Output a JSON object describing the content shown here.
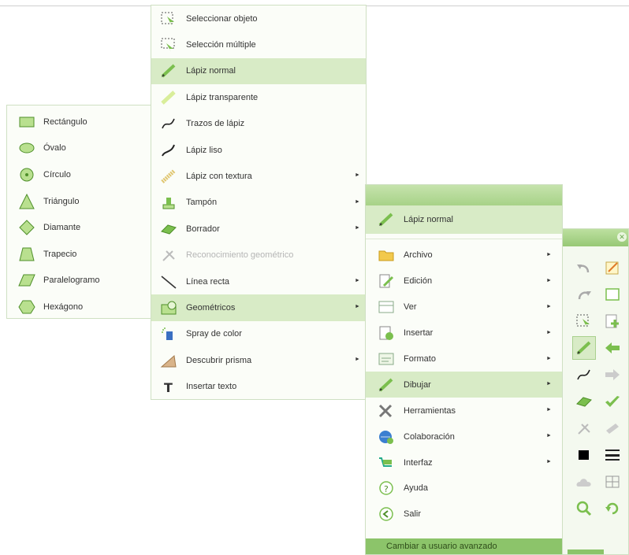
{
  "colors": {
    "accent": "#8cc46a",
    "highlight": "#d8ebc6",
    "border": "#cfe0c3"
  },
  "geometric_menu": {
    "items": [
      {
        "label": "Rectángulo",
        "icon": "rectangle-icon"
      },
      {
        "label": "Óvalo",
        "icon": "oval-icon"
      },
      {
        "label": "Círculo",
        "icon": "circle-icon"
      },
      {
        "label": "Triángulo",
        "icon": "triangle-icon"
      },
      {
        "label": "Diamante",
        "icon": "diamond-icon"
      },
      {
        "label": "Trapecio",
        "icon": "trapezoid-icon"
      },
      {
        "label": "Paralelogramo",
        "icon": "parallelogram-icon"
      },
      {
        "label": "Hexágono",
        "icon": "hexagon-icon"
      }
    ]
  },
  "draw_menu": {
    "items": [
      {
        "label": "Seleccionar objeto",
        "icon": "select-object-icon"
      },
      {
        "label": "Selección múltiple",
        "icon": "multi-select-icon"
      },
      {
        "label": "Lápiz normal",
        "icon": "normal-pencil-icon"
      },
      {
        "label": "Lápiz transparente",
        "icon": "transparent-pencil-icon"
      },
      {
        "label": "Trazos de lápiz",
        "icon": "pencil-strokes-icon"
      },
      {
        "label": "Lápiz liso",
        "icon": "smooth-pencil-icon"
      },
      {
        "label": "Lápiz con textura",
        "icon": "texture-pencil-icon",
        "submenu": "►"
      },
      {
        "label": "Tampón",
        "icon": "stamp-icon",
        "submenu": "►"
      },
      {
        "label": "Borrador",
        "icon": "eraser-icon",
        "submenu": "►"
      },
      {
        "label": "Reconocimiento geométrico",
        "icon": "shape-recognition-icon",
        "disabled": true
      },
      {
        "label": "Línea recta",
        "icon": "straight-line-icon",
        "submenu": "►"
      },
      {
        "label": "Geométricos",
        "icon": "geometric-shapes-icon",
        "submenu": "►"
      },
      {
        "label": "Spray de color",
        "icon": "spray-icon"
      },
      {
        "label": "Descubrir prisma",
        "icon": "reveal-prism-icon",
        "submenu": "►"
      },
      {
        "label": "Insertar texto",
        "icon": "insert-text-icon"
      }
    ]
  },
  "main_menu": {
    "current_tool": {
      "label": "Lápiz normal",
      "icon": "normal-pencil-icon"
    },
    "items": [
      {
        "label": "Archivo",
        "icon": "folder-icon",
        "submenu": "►"
      },
      {
        "label": "Edición",
        "icon": "edit-icon",
        "submenu": "►"
      },
      {
        "label": "Ver",
        "icon": "view-icon",
        "submenu": "►"
      },
      {
        "label": "Insertar",
        "icon": "insert-icon",
        "submenu": "►"
      },
      {
        "label": "Formato",
        "icon": "format-icon",
        "submenu": "►"
      },
      {
        "label": "Dibujar",
        "icon": "draw-icon",
        "submenu": "►"
      },
      {
        "label": "Herramientas",
        "icon": "tools-icon",
        "submenu": "►"
      },
      {
        "label": "Colaboración",
        "icon": "collaboration-icon",
        "submenu": "►"
      },
      {
        "label": "Interfaz",
        "icon": "interface-icon",
        "submenu": "►"
      },
      {
        "label": "Ayuda",
        "icon": "help-icon"
      },
      {
        "label": "Salir",
        "icon": "exit-icon"
      }
    ],
    "footer": "Cambiar a usuario avanzado"
  },
  "toolbar": {
    "title": "",
    "close": "✕",
    "tools": [
      "undo-icon",
      "note-icon",
      "redo-icon",
      "frame-icon",
      "select-icon",
      "add-page-icon",
      "pencil-icon",
      "back-arrow-icon",
      "strokes-icon",
      "forward-arrow-icon",
      "eraser-icon",
      "check-icon",
      "recognition-icon",
      "tape-icon",
      "color-swatch-icon",
      "line-width-icon",
      "cloud-icon",
      "grid-icon",
      "zoom-icon",
      "refresh-icon"
    ]
  }
}
